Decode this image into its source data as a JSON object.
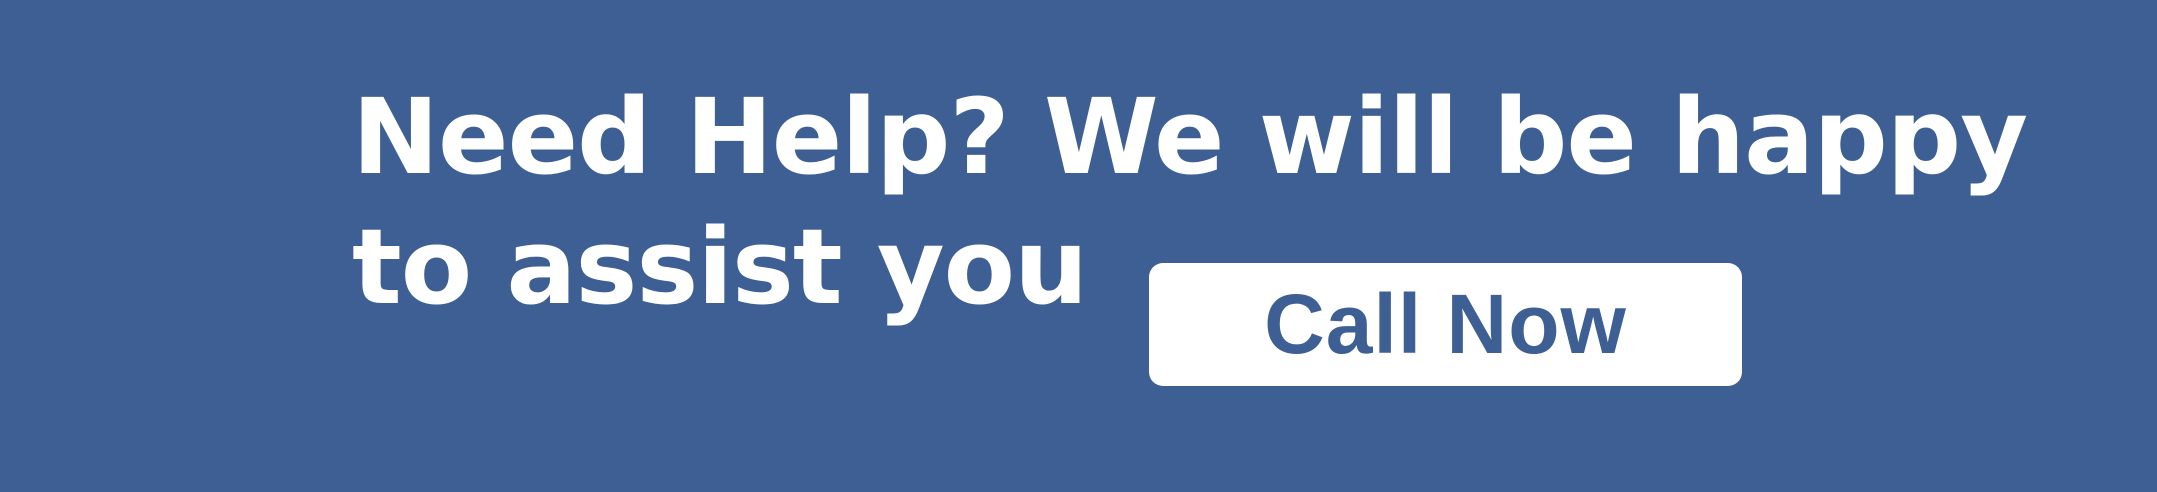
{
  "banner": {
    "headline": "Need Help? We will be happy to assist you",
    "cta_label": "Call Now"
  },
  "colors": {
    "background": "#3d5f94",
    "button_background": "#ffffff",
    "button_text": "#3d5f94",
    "headline_text": "#ffffff"
  }
}
